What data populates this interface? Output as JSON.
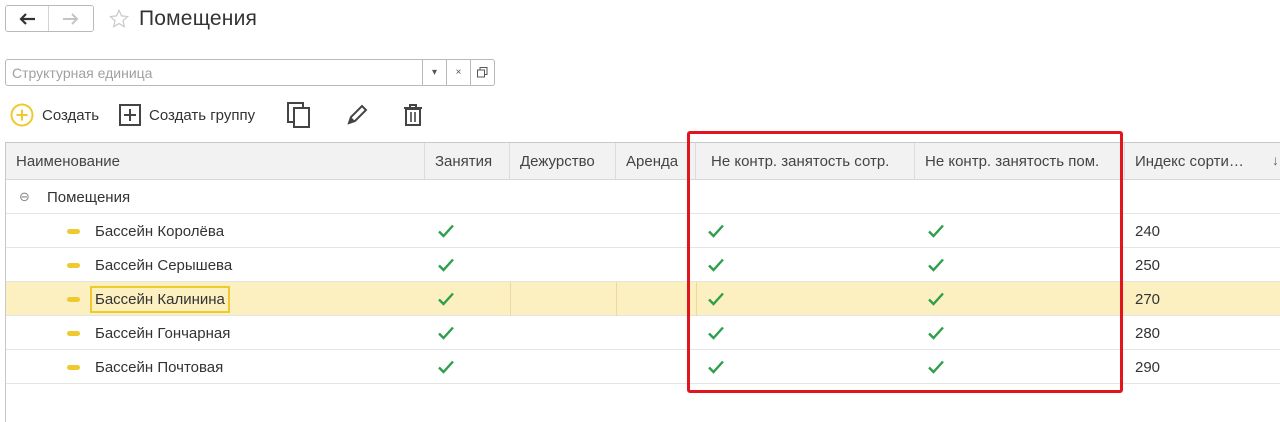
{
  "window": {
    "title": "Помещения"
  },
  "nav": {
    "back_icon": "arrow-left-icon",
    "forward_icon": "arrow-right-icon",
    "favorite_icon": "star-icon"
  },
  "filter": {
    "placeholder": "Структурная единица"
  },
  "toolbar": {
    "create_label": "Создать",
    "create_group_label": "Создать группу"
  },
  "table": {
    "columns": [
      "Наименование",
      "Занятия",
      "Дежурство",
      "Аренда",
      "Не контр. занятость сотр.",
      "Не контр. занятость пом.",
      "Индекс сорти…"
    ],
    "group": {
      "label": "Помещения",
      "expander": "⊖"
    },
    "rows": [
      {
        "name": "Бассейн Королёва",
        "classes": true,
        "duty": false,
        "rent": false,
        "staff": true,
        "room": true,
        "index": "240"
      },
      {
        "name": "Бассейн Серышева",
        "classes": true,
        "duty": false,
        "rent": false,
        "staff": true,
        "room": true,
        "index": "250"
      },
      {
        "name": "Бассейн Калинина",
        "classes": true,
        "duty": false,
        "rent": false,
        "staff": true,
        "room": true,
        "index": "270",
        "selected": true
      },
      {
        "name": "Бассейн Гончарная",
        "classes": true,
        "duty": false,
        "rent": false,
        "staff": true,
        "room": true,
        "index": "280"
      },
      {
        "name": "Бассейн Почтовая",
        "classes": true,
        "duty": false,
        "rent": false,
        "staff": true,
        "room": true,
        "index": "290"
      }
    ]
  },
  "colors": {
    "accent_yellow": "#f0c92d",
    "check_green": "#2e9f4a",
    "highlight_red": "#e3151c",
    "selected_row": "#fcefc0"
  }
}
